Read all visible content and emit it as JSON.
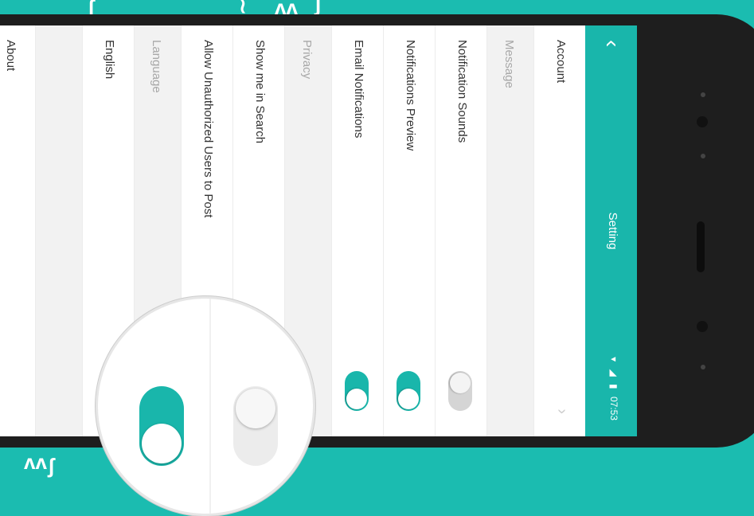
{
  "app": {
    "title": "Setting",
    "back_icon": "chevron-left-icon"
  },
  "status_bar": {
    "time": "07:53"
  },
  "rows": [
    {
      "label": "Account",
      "type": "nav"
    },
    {
      "label": "Message",
      "type": "section"
    },
    {
      "label": "Notification Sounds",
      "type": "toggle",
      "on": false
    },
    {
      "label": "Notifications Preview",
      "type": "toggle",
      "on": true
    },
    {
      "label": "Email Notifications",
      "type": "toggle",
      "on": true
    },
    {
      "label": "Privacy",
      "type": "section"
    },
    {
      "label": "Show me in Search",
      "type": "plain"
    },
    {
      "label": "Allow Unauthorized Users to Post",
      "type": "plain"
    },
    {
      "label": "Language",
      "type": "section"
    },
    {
      "label": "English",
      "type": "plain"
    },
    {
      "label": "",
      "type": "section"
    },
    {
      "label": "About",
      "type": "plain"
    }
  ],
  "magnifier": {
    "toggle_on": true,
    "toggle_off": false
  },
  "colors": {
    "accent": "#19b6ab",
    "background": "#1bbcb0"
  }
}
